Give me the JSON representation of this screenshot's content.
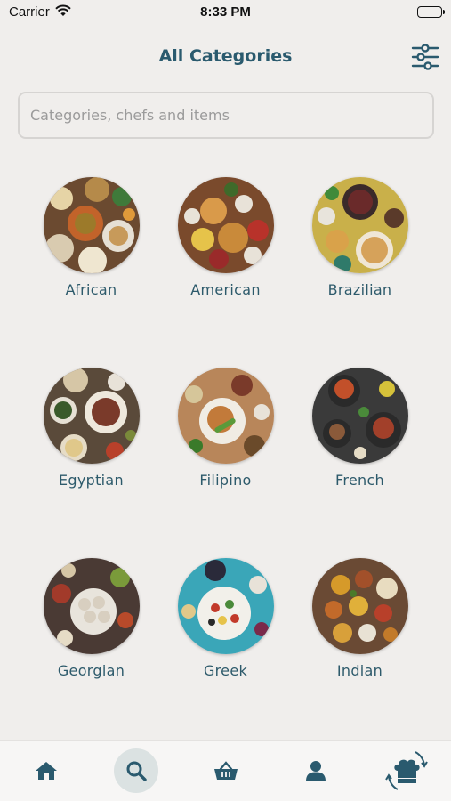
{
  "status": {
    "carrier": "Carrier",
    "time": "8:33 PM"
  },
  "header": {
    "title": "All Categories"
  },
  "search": {
    "placeholder": "Categories, chefs and items"
  },
  "colors": {
    "accent": "#2a5a6e",
    "background": "#f0eeec",
    "tab_active": "#dbe2e2"
  },
  "categories": [
    {
      "label": "African"
    },
    {
      "label": "American"
    },
    {
      "label": "Brazilian"
    },
    {
      "label": "Egyptian"
    },
    {
      "label": "Filipino"
    },
    {
      "label": "French"
    },
    {
      "label": "Georgian"
    },
    {
      "label": "Greek"
    },
    {
      "label": "Indian"
    }
  ],
  "tabs": [
    {
      "icon": "home-icon"
    },
    {
      "icon": "search-icon",
      "active": true
    },
    {
      "icon": "basket-icon"
    },
    {
      "icon": "user-icon"
    },
    {
      "icon": "chef-switch-icon"
    }
  ]
}
